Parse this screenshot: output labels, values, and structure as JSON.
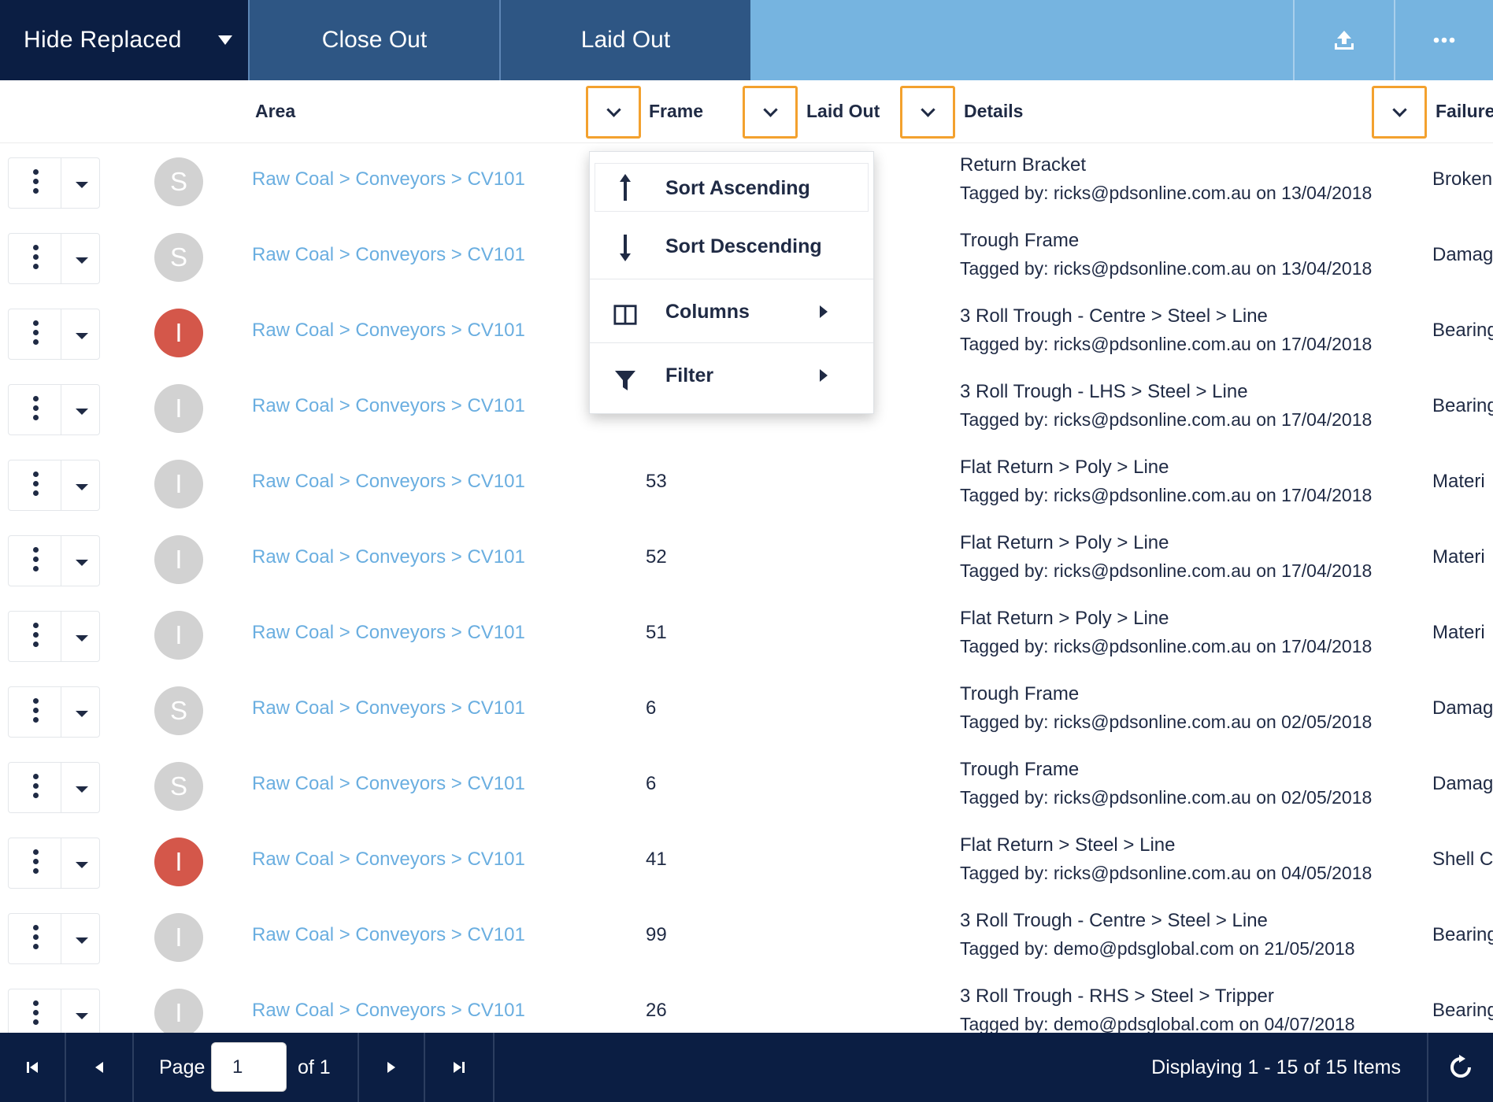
{
  "toolbar": {
    "hide_label": "Hide Replaced",
    "close_out_label": "Close Out",
    "laid_out_label": "Laid Out"
  },
  "columns": {
    "area": "Area",
    "frame": "Frame",
    "laid_out": "Laid Out",
    "details": "Details",
    "failure": "Failure"
  },
  "context_menu": {
    "sort_ascending": "Sort Ascending",
    "sort_descending": "Sort Descending",
    "columns": "Columns",
    "filter": "Filter"
  },
  "rows": [
    {
      "status": "S",
      "area": "Raw Coal > Conveyors > CV101",
      "frame": "",
      "detail": "Return Bracket",
      "tagged": "Tagged by: ricks@pdsonline.com.au on 13/04/2018",
      "failure": "Broken"
    },
    {
      "status": "S",
      "area": "Raw Coal > Conveyors > CV101",
      "frame": "",
      "detail": "Trough Frame",
      "tagged": "Tagged by: ricks@pdsonline.com.au on 13/04/2018",
      "failure": "Damag"
    },
    {
      "status": "I",
      "area": "Raw Coal > Conveyors > CV101",
      "frame": "",
      "detail": "3 Roll Trough - Centre > Steel > Line",
      "tagged": "Tagged by: ricks@pdsonline.com.au on 17/04/2018",
      "failure": "Bearing"
    },
    {
      "status": "I",
      "area": "Raw Coal > Conveyors > CV101",
      "frame": "",
      "detail": "3 Roll Trough - LHS > Steel > Line",
      "tagged": "Tagged by: ricks@pdsonline.com.au on 17/04/2018",
      "failure": "Bearing"
    },
    {
      "status": "I",
      "area": "Raw Coal > Conveyors > CV101",
      "frame": "53",
      "detail": "Flat Return > Poly > Line",
      "tagged": "Tagged by: ricks@pdsonline.com.au on 17/04/2018",
      "failure": "Materi"
    },
    {
      "status": "I",
      "area": "Raw Coal > Conveyors > CV101",
      "frame": "52",
      "detail": "Flat Return > Poly > Line",
      "tagged": "Tagged by: ricks@pdsonline.com.au on 17/04/2018",
      "failure": "Materi"
    },
    {
      "status": "I",
      "area": "Raw Coal > Conveyors > CV101",
      "frame": "51",
      "detail": "Flat Return > Poly > Line",
      "tagged": "Tagged by: ricks@pdsonline.com.au on 17/04/2018",
      "failure": "Materi"
    },
    {
      "status": "S",
      "area": "Raw Coal > Conveyors > CV101",
      "frame": "6",
      "detail": "Trough Frame",
      "tagged": "Tagged by: ricks@pdsonline.com.au on 02/05/2018",
      "failure": "Damag"
    },
    {
      "status": "S",
      "area": "Raw Coal > Conveyors > CV101",
      "frame": "6",
      "detail": "Trough Frame",
      "tagged": "Tagged by: ricks@pdsonline.com.au on 02/05/2018",
      "failure": "Damag"
    },
    {
      "status": "I",
      "area": "Raw Coal > Conveyors > CV101",
      "frame": "41",
      "detail": "Flat Return > Steel > Line",
      "tagged": "Tagged by: ricks@pdsonline.com.au on 04/05/2018",
      "failure": "Shell C"
    },
    {
      "status": "I",
      "area": "Raw Coal > Conveyors > CV101",
      "frame": "99",
      "detail": "3 Roll Trough - Centre > Steel > Line",
      "tagged": "Tagged by: demo@pdsglobal.com on 21/05/2018",
      "failure": "Bearing"
    },
    {
      "status": "I",
      "area": "Raw Coal > Conveyors > CV101",
      "frame": "26",
      "detail": "3 Roll Trough - RHS > Steel > Tripper",
      "tagged": "Tagged by: demo@pdsglobal.com on 04/07/2018",
      "failure": "Bearing"
    }
  ],
  "footer": {
    "page_label": "Page",
    "page_value": "1",
    "of_label": "of 1",
    "displaying": "Displaying 1 - 15 of 15 Items"
  },
  "colors": {
    "navy": "#0b1e43",
    "toolbar_button": "#2e5684",
    "toolbar_bg": "#76b4e0",
    "link": "#6aaee0",
    "highlight_orange": "#f3a12e",
    "avatar_red": "#d4574a",
    "avatar_grey": "#d2d2d2"
  },
  "icons": {
    "upload": "upload-icon",
    "more": "more-horizontal-icon",
    "refresh": "refresh-icon"
  }
}
